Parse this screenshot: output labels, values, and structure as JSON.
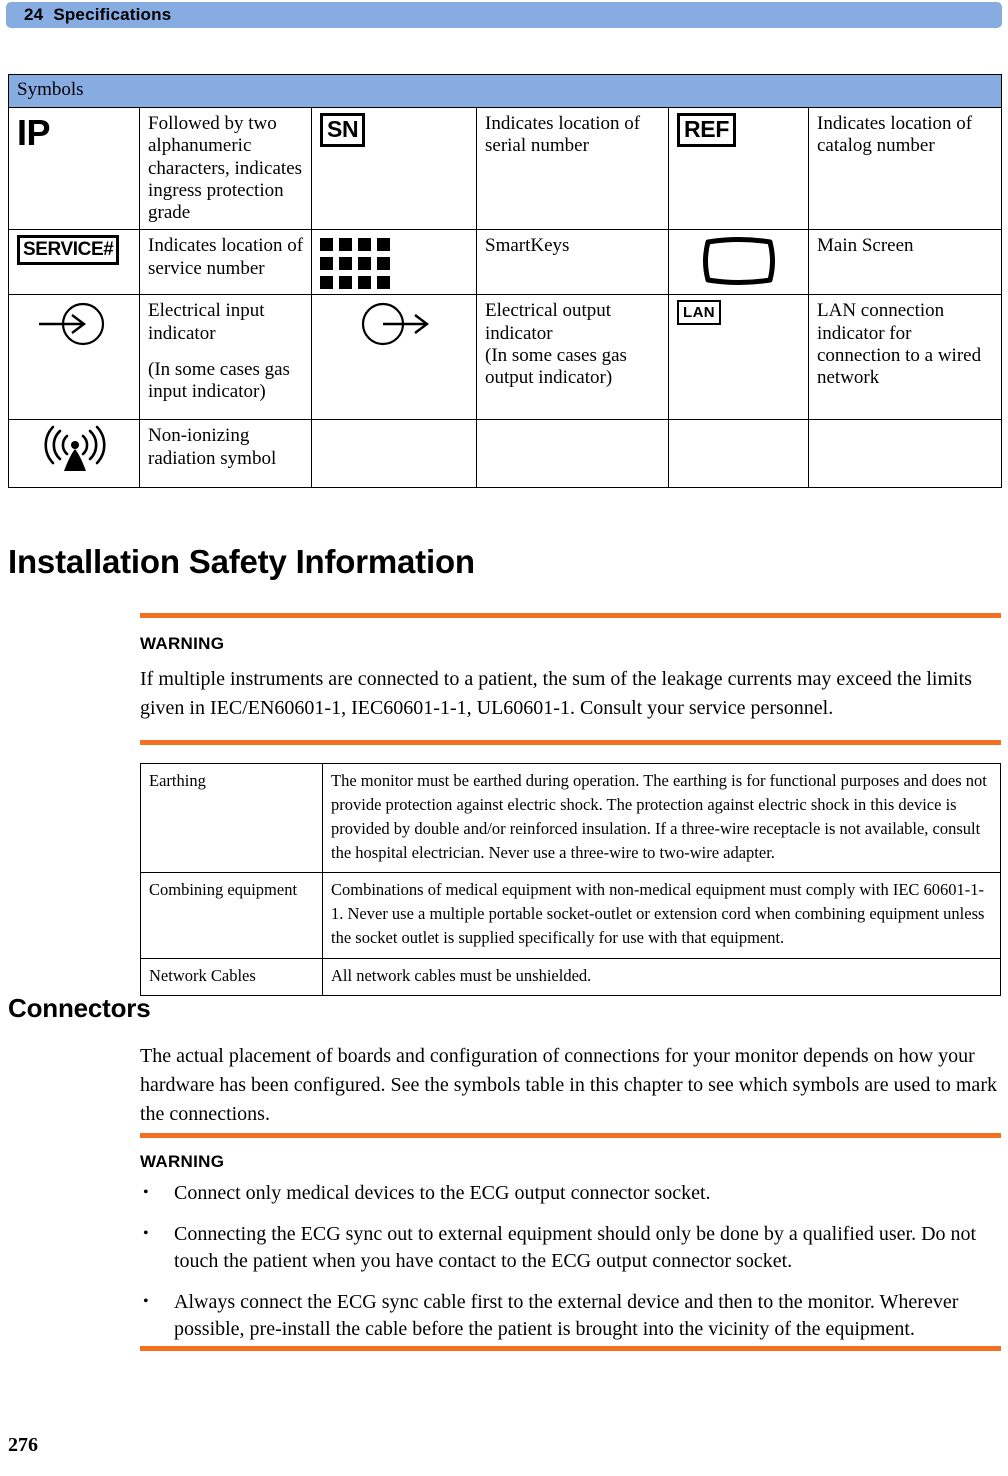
{
  "header": {
    "chapter_number": "24",
    "chapter_title": "Specifications"
  },
  "symbols_table": {
    "caption": "Symbols",
    "rows": [
      {
        "symbol1_name": "ip-rating-symbol",
        "symbol1_text": "IP",
        "desc1": "Followed by two alphanumeric characters, indicates ingress protection grade",
        "symbol2_name": "serial-number-symbol",
        "symbol2_text": "SN",
        "desc2": "Indicates location of serial number",
        "symbol3_name": "catalog-number-symbol",
        "symbol3_text": "REF",
        "desc3": "Indicates location of catalog number"
      },
      {
        "symbol1_name": "service-number-symbol",
        "symbol1_text": "SERVICE#",
        "desc1": "Indicates location of service number",
        "symbol2_name": "smartkeys-grid-icon",
        "symbol2_text": "",
        "desc2": "SmartKeys",
        "symbol3_name": "main-screen-icon",
        "symbol3_text": "",
        "desc3": "Main Screen"
      },
      {
        "symbol1_name": "electrical-input-icon",
        "symbol1_text": "",
        "desc1": "Electrical input indicator",
        "desc1_note": "(In some cases gas input indicator)",
        "symbol2_name": "electrical-output-icon",
        "symbol2_text": "",
        "desc2": "Electrical output indicator",
        "desc2_note": "(In some cases gas output indicator)",
        "symbol3_name": "lan-connection-symbol",
        "symbol3_text": "LAN",
        "desc3": "LAN connection indicator for connection to a wired network"
      },
      {
        "symbol1_name": "non-ionizing-radiation-icon",
        "symbol1_text": "",
        "desc1": "Non-ionizing radiation symbol",
        "symbol2_name": "",
        "symbol2_text": "",
        "desc2": "",
        "symbol3_name": "",
        "symbol3_text": "",
        "desc3": ""
      }
    ]
  },
  "installation": {
    "heading": "Installation Safety Information",
    "warning_label": "WARNING",
    "warning_text": "If multiple instruments are connected to a patient, the sum of the leakage currents may exceed the limits given in IEC/EN60601-1, IEC60601-1-1, UL60601-1. Consult your service personnel."
  },
  "info_table": {
    "rows": [
      {
        "label": "Earthing",
        "text": "The monitor must be earthed during operation. The earthing is for functional purposes and does not provide protection against electric shock. The protection against electric shock in this device is provided by double and/or reinforced insulation. If a three-wire receptacle is not available, consult the hospital electrician. Never use a three-wire to two-wire adapter."
      },
      {
        "label": "Combining equipment",
        "text": "Combinations of medical equipment with non-medical equipment must comply with IEC 60601-1-1. Never use a multiple portable socket-outlet or extension cord when combining equipment unless the socket outlet is supplied specifically for use with that equipment."
      },
      {
        "label": "Network Cables",
        "text": "All network cables must be unshielded."
      }
    ]
  },
  "connectors": {
    "heading": "Connectors",
    "intro": "The actual placement of boards and configuration of connections for your monitor depends on how your hardware has been configured. See the symbols table in this chapter to see which symbols are used to mark the connections.",
    "warning_label": "WARNING",
    "bullet_marker": "•",
    "bullets": [
      "Connect only medical devices to the ECG output connector socket.",
      "Connecting the ECG sync out to external equipment should only be done by a qualified user. Do not touch the patient when you have contact to the ECG output connector socket.",
      "Always connect the ECG sync cable first to the external device and then to the monitor. Wherever possible, pre-install the cable before the patient is brought into the vicinity of the equipment."
    ]
  },
  "footer": {
    "page_number": "276"
  },
  "colors": {
    "header_blue": "#86ace2",
    "warning_orange": "#f2701f",
    "text_black": "#000000"
  }
}
